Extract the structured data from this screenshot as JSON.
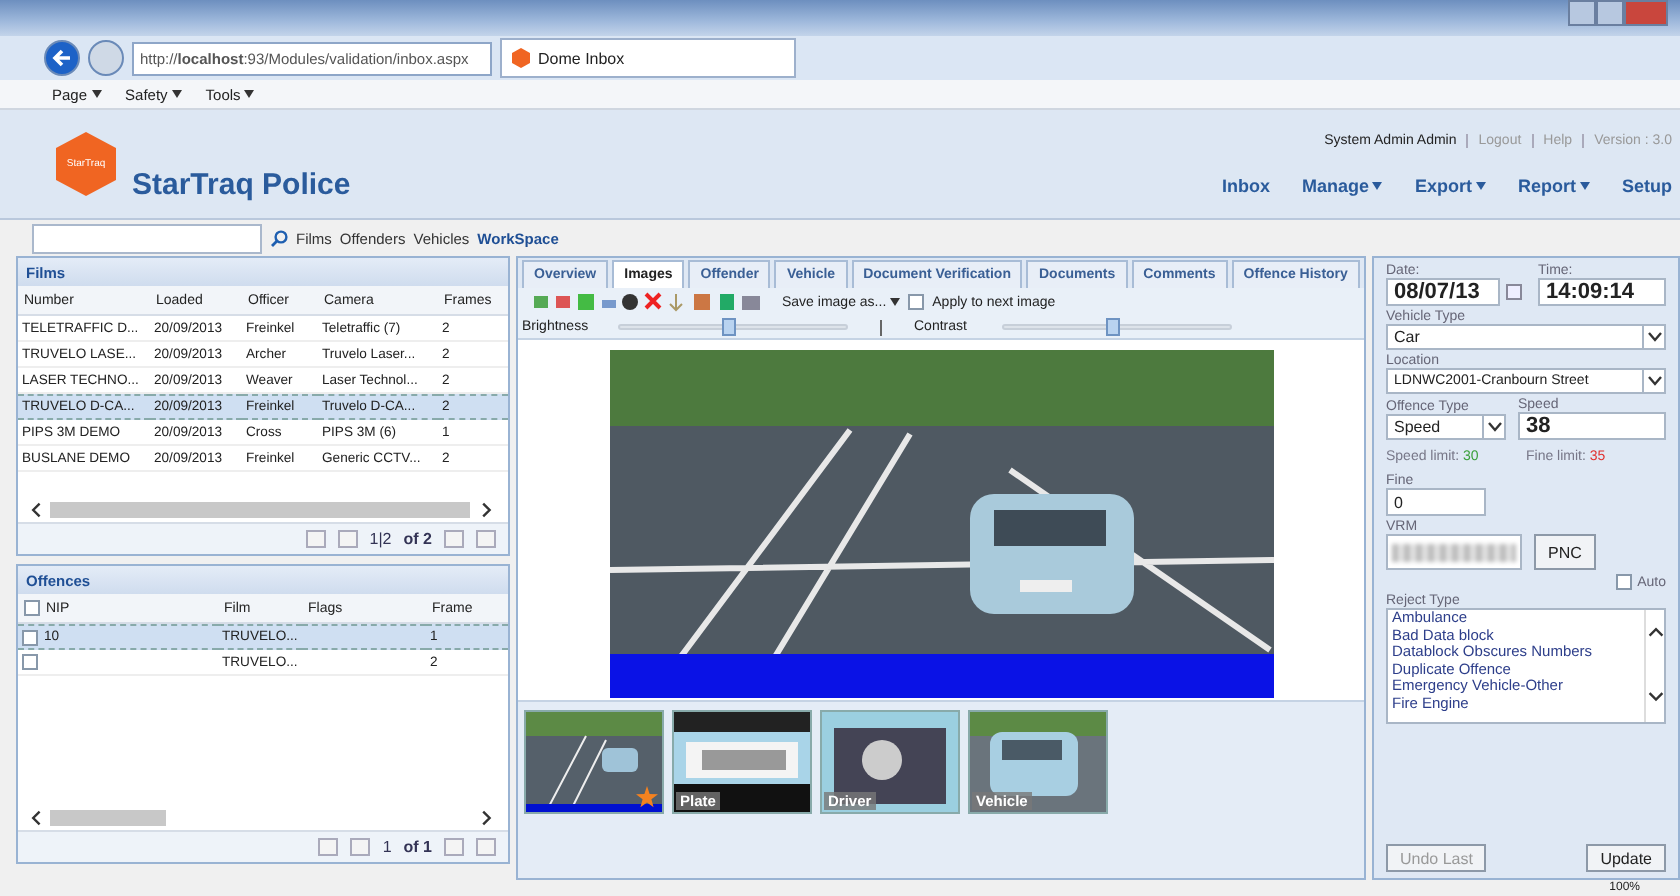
{
  "browser": {
    "address_prefix": "http://",
    "address_host": "localhost",
    "address_rest": ":93/Modules/validation/inbox.aspx",
    "tab_title": "Dome Inbox",
    "commands": [
      "Page",
      "Safety",
      "Tools"
    ]
  },
  "header": {
    "logo_text": "StarTraq",
    "title": "StarTraq Police",
    "user": "System Admin Admin",
    "links": [
      "Logout",
      "Help",
      "Version : 3.0"
    ],
    "nav": [
      {
        "label": "Inbox",
        "menu": false
      },
      {
        "label": "Manage",
        "menu": true
      },
      {
        "label": "Export",
        "menu": true
      },
      {
        "label": "Report",
        "menu": true
      },
      {
        "label": "Setup",
        "menu": false
      }
    ]
  },
  "search": {
    "links": [
      {
        "label": "Films",
        "selected": false
      },
      {
        "label": "Offenders",
        "selected": false
      },
      {
        "label": "Vehicles",
        "selected": false
      },
      {
        "label": "WorkSpace",
        "selected": true
      }
    ]
  },
  "films": {
    "title": "Films",
    "columns": [
      "Number",
      "Loaded",
      "Officer",
      "Camera",
      "Frames"
    ],
    "rows": [
      {
        "selected": false,
        "cells": [
          "TELETRAFFIC D...",
          "20/09/2013",
          "Freinkel",
          "Teletraffic (7)",
          "2"
        ]
      },
      {
        "selected": false,
        "cells": [
          "TRUVELO LASE...",
          "20/09/2013",
          "Archer",
          "Truvelo Laser...",
          "2"
        ]
      },
      {
        "selected": false,
        "cells": [
          "LASER TECHNO...",
          "20/09/2013",
          "Weaver",
          "Laser Technol...",
          "2"
        ]
      },
      {
        "selected": true,
        "cells": [
          "TRUVELO D-CA...",
          "20/09/2013",
          "Freinkel",
          "Truvelo D-CA...",
          "2"
        ]
      },
      {
        "selected": false,
        "cells": [
          "PIPS 3M DEMO",
          "20/09/2013",
          "Cross",
          "PIPS 3M (6)",
          "1"
        ]
      },
      {
        "selected": false,
        "cells": [
          "BUSLANE DEMO",
          "20/09/2013",
          "Freinkel",
          "Generic CCTV...",
          "2"
        ]
      }
    ],
    "pager": {
      "page": "1|2",
      "total": "of 2"
    }
  },
  "offences": {
    "title": "Offences",
    "all_checked": false,
    "columns": [
      "NIP",
      "Film",
      "Flags",
      "Frame"
    ],
    "rows": [
      {
        "selected": true,
        "checked": false,
        "cells": [
          "10",
          "TRUVELO...",
          "",
          "1"
        ]
      },
      {
        "selected": false,
        "checked": false,
        "cells": [
          "",
          "TRUVELO...",
          "",
          "2"
        ]
      }
    ],
    "pager": {
      "page": "1",
      "total": "of 1"
    }
  },
  "tabs": [
    {
      "label": "Overview",
      "selected": false
    },
    {
      "label": "Images",
      "selected": true
    },
    {
      "label": "Offender",
      "selected": false
    },
    {
      "label": "Vehicle",
      "selected": false
    },
    {
      "label": "Document Verification",
      "selected": false
    },
    {
      "label": "Documents",
      "selected": false
    },
    {
      "label": "Comments",
      "selected": false
    },
    {
      "label": "Offence History",
      "selected": false
    }
  ],
  "toolbar": {
    "save_label": "Save image as...",
    "apply": {
      "label": "Apply to next image",
      "checked": false
    }
  },
  "sliders": [
    {
      "label": "Brightness",
      "level": 0.48
    },
    {
      "label": "Contrast",
      "level": 0.48
    }
  ],
  "thumbnails": [
    {
      "kind": "scene",
      "starred": true
    },
    {
      "kind": "plate",
      "label": "Plate",
      "starred": false
    },
    {
      "kind": "driver",
      "label": "Driver",
      "starred": false
    },
    {
      "kind": "vehicle",
      "label": "Vehicle",
      "starred": false
    }
  ],
  "form": {
    "date_label": "Date:",
    "date": "08/07/13",
    "time_label": "Time:",
    "time": "14:09:14",
    "vehicle_type_label": "Vehicle Type",
    "vehicle_type": "Car",
    "location_label": "Location",
    "location": "LDNWC2001-Cranbourn Street",
    "offence_type_label": "Offence Type",
    "offence_type": "Speed",
    "speed_label": "Speed",
    "speed": "38",
    "limits": [
      {
        "label": "Speed limit:",
        "value": "30",
        "color": "#3aa03a"
      },
      {
        "label": "Fine limit:",
        "value": "35",
        "color": "#e03030"
      }
    ],
    "fine_label": "Fine",
    "fine": "0",
    "vrm_label": "VRM",
    "pnc": "PNC",
    "auto": {
      "label": "Auto",
      "checked": false
    },
    "reject_label": "Reject Type",
    "reject_types": [
      "Ambulance",
      "Bad Data block",
      "Datablock Obscures Numbers",
      "Duplicate Offence",
      "Emergency Vehicle-Other",
      "Fire Engine"
    ],
    "buttons": [
      {
        "label": "Undo Last",
        "disabled": true
      },
      {
        "label": "Update",
        "disabled": false
      }
    ]
  },
  "status": {
    "zoom": "100%"
  }
}
